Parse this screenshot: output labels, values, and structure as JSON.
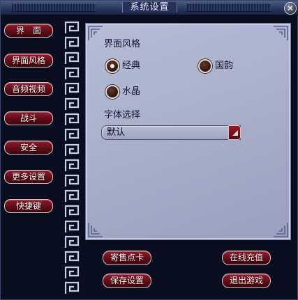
{
  "window": {
    "title": "系统设置",
    "close_symbol": "✕"
  },
  "nav": {
    "items": [
      {
        "label": "界　面"
      },
      {
        "label": "界面风格"
      },
      {
        "label": "音频视频"
      },
      {
        "label": "战斗"
      },
      {
        "label": "安全"
      },
      {
        "label": "更多设置"
      },
      {
        "label": "快捷键"
      }
    ]
  },
  "panel": {
    "style_section_label": "界面风格",
    "style_options": [
      {
        "label": "经典",
        "selected": true
      },
      {
        "label": "国韵",
        "selected": false
      },
      {
        "label": "水晶",
        "selected": false
      }
    ],
    "font_section_label": "字体选择",
    "font_select_value": "默认"
  },
  "actions": {
    "consign_label": "寄售点卡",
    "recharge_label": "在线充值",
    "save_label": "保存设置",
    "exit_label": "退出游戏"
  },
  "colors": {
    "button_red": "#7a1222",
    "panel_bg": "#aeb3cc",
    "window_bg": "#0a0d1e"
  }
}
